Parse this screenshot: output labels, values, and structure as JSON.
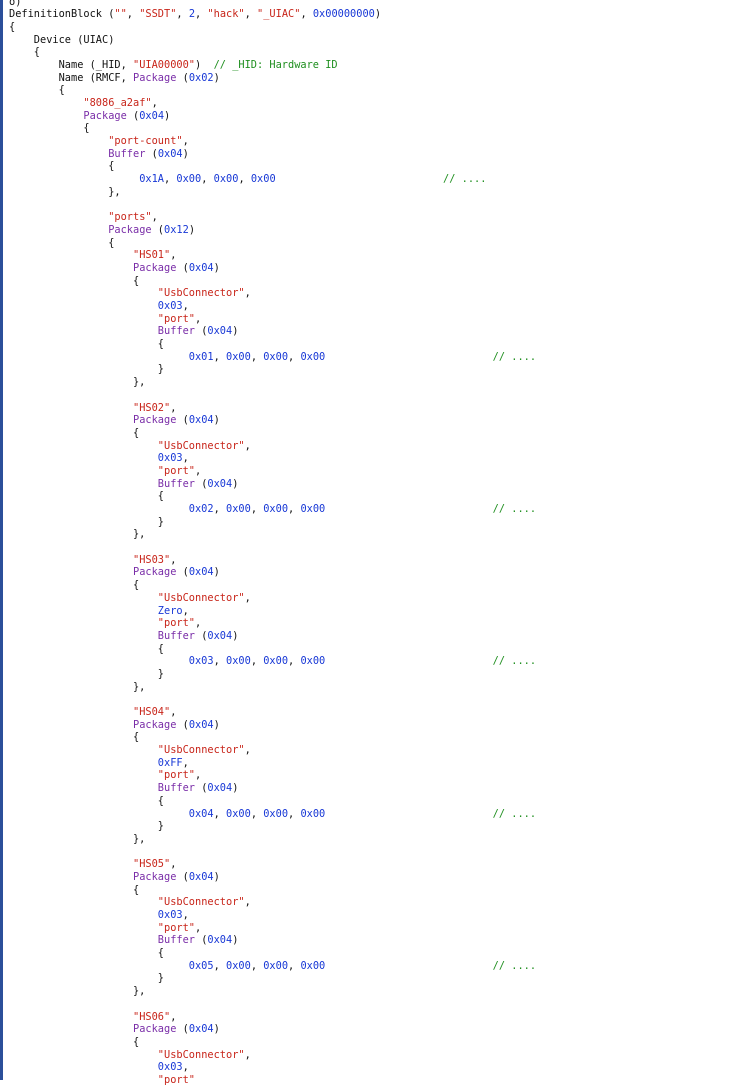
{
  "colors": {
    "text": "#111111",
    "keyword": "#7a2ea8",
    "string": "#c8251a",
    "number": "#1838d6",
    "comment": "#1f8f1f",
    "gutter": "#2b4f9a"
  },
  "editor": {
    "lines": [
      [
        {
          "t": "o)",
          "k": "t"
        }
      ],
      [
        {
          "t": "DefinitionBlock (",
          "k": "t"
        },
        {
          "t": "\"\"",
          "k": "s"
        },
        {
          "t": ", ",
          "k": "t"
        },
        {
          "t": "\"SSDT\"",
          "k": "s"
        },
        {
          "t": ", ",
          "k": "t"
        },
        {
          "t": "2",
          "k": "n"
        },
        {
          "t": ", ",
          "k": "t"
        },
        {
          "t": "\"hack\"",
          "k": "s"
        },
        {
          "t": ", ",
          "k": "t"
        },
        {
          "t": "\"_UIAC\"",
          "k": "s"
        },
        {
          "t": ", ",
          "k": "t"
        },
        {
          "t": "0x00000000",
          "k": "n"
        },
        {
          "t": ")",
          "k": "t"
        }
      ],
      [
        {
          "t": "{",
          "k": "t"
        }
      ],
      [
        {
          "t": "    Device (UIAC)",
          "k": "t"
        }
      ],
      [
        {
          "t": "    {",
          "k": "t"
        }
      ],
      [
        {
          "t": "        Name (_HID, ",
          "k": "t"
        },
        {
          "t": "\"UIA00000\"",
          "k": "s"
        },
        {
          "t": ")  ",
          "k": "t"
        },
        {
          "t": "// _HID: Hardware ID",
          "k": "c"
        }
      ],
      [
        {
          "t": "        Name (RMCF, ",
          "k": "t"
        },
        {
          "t": "Package",
          "k": "k"
        },
        {
          "t": " (",
          "k": "t"
        },
        {
          "t": "0x02",
          "k": "n"
        },
        {
          "t": ")",
          "k": "t"
        }
      ],
      [
        {
          "t": "        {",
          "k": "t"
        }
      ],
      [
        {
          "t": "            ",
          "k": "t"
        },
        {
          "t": "\"8086_a2af\"",
          "k": "s"
        },
        {
          "t": ",",
          "k": "t"
        }
      ],
      [
        {
          "t": "            ",
          "k": "t"
        },
        {
          "t": "Package",
          "k": "k"
        },
        {
          "t": " (",
          "k": "t"
        },
        {
          "t": "0x04",
          "k": "n"
        },
        {
          "t": ")",
          "k": "t"
        }
      ],
      [
        {
          "t": "            {",
          "k": "t"
        }
      ],
      [
        {
          "t": "                ",
          "k": "t"
        },
        {
          "t": "\"port-count\"",
          "k": "s"
        },
        {
          "t": ",",
          "k": "t"
        }
      ],
      [
        {
          "t": "                ",
          "k": "t"
        },
        {
          "t": "Buffer",
          "k": "k"
        },
        {
          "t": " (",
          "k": "t"
        },
        {
          "t": "0x04",
          "k": "n"
        },
        {
          "t": ")",
          "k": "t"
        }
      ],
      [
        {
          "t": "                {",
          "k": "t"
        }
      ],
      [
        {
          "t": "                     ",
          "k": "t"
        },
        {
          "t": "0x1A",
          "k": "n"
        },
        {
          "t": ", ",
          "k": "t"
        },
        {
          "t": "0x00",
          "k": "n"
        },
        {
          "t": ", ",
          "k": "t"
        },
        {
          "t": "0x00",
          "k": "n"
        },
        {
          "t": ", ",
          "k": "t"
        },
        {
          "t": "0x00",
          "k": "n"
        },
        {
          "t": "                           ",
          "k": "t"
        },
        {
          "t": "// ....",
          "k": "c"
        }
      ],
      [
        {
          "t": "                },",
          "k": "t"
        }
      ],
      [
        {
          "t": "",
          "k": "t"
        }
      ],
      [
        {
          "t": "                ",
          "k": "t"
        },
        {
          "t": "\"ports\"",
          "k": "s"
        },
        {
          "t": ",",
          "k": "t"
        }
      ],
      [
        {
          "t": "                ",
          "k": "t"
        },
        {
          "t": "Package",
          "k": "k"
        },
        {
          "t": " (",
          "k": "t"
        },
        {
          "t": "0x12",
          "k": "n"
        },
        {
          "t": ")",
          "k": "t"
        }
      ],
      [
        {
          "t": "                {",
          "k": "t"
        }
      ],
      [
        {
          "t": "                    ",
          "k": "t"
        },
        {
          "t": "\"HS01\"",
          "k": "s"
        },
        {
          "t": ",",
          "k": "t"
        }
      ],
      [
        {
          "t": "                    ",
          "k": "t"
        },
        {
          "t": "Package",
          "k": "k"
        },
        {
          "t": " (",
          "k": "t"
        },
        {
          "t": "0x04",
          "k": "n"
        },
        {
          "t": ")",
          "k": "t"
        }
      ],
      [
        {
          "t": "                    {",
          "k": "t"
        }
      ],
      [
        {
          "t": "                        ",
          "k": "t"
        },
        {
          "t": "\"UsbConnector\"",
          "k": "s"
        },
        {
          "t": ",",
          "k": "t"
        }
      ],
      [
        {
          "t": "                        ",
          "k": "t"
        },
        {
          "t": "0x03",
          "k": "n"
        },
        {
          "t": ",",
          "k": "t"
        }
      ],
      [
        {
          "t": "                        ",
          "k": "t"
        },
        {
          "t": "\"port\"",
          "k": "s"
        },
        {
          "t": ",",
          "k": "t"
        }
      ],
      [
        {
          "t": "                        ",
          "k": "t"
        },
        {
          "t": "Buffer",
          "k": "k"
        },
        {
          "t": " (",
          "k": "t"
        },
        {
          "t": "0x04",
          "k": "n"
        },
        {
          "t": ")",
          "k": "t"
        }
      ],
      [
        {
          "t": "                        {",
          "k": "t"
        }
      ],
      [
        {
          "t": "                             ",
          "k": "t"
        },
        {
          "t": "0x01",
          "k": "n"
        },
        {
          "t": ", ",
          "k": "t"
        },
        {
          "t": "0x00",
          "k": "n"
        },
        {
          "t": ", ",
          "k": "t"
        },
        {
          "t": "0x00",
          "k": "n"
        },
        {
          "t": ", ",
          "k": "t"
        },
        {
          "t": "0x00",
          "k": "n"
        },
        {
          "t": "                           ",
          "k": "t"
        },
        {
          "t": "// ....",
          "k": "c"
        }
      ],
      [
        {
          "t": "                        }",
          "k": "t"
        }
      ],
      [
        {
          "t": "                    },",
          "k": "t"
        }
      ],
      [
        {
          "t": "",
          "k": "t"
        }
      ],
      [
        {
          "t": "                    ",
          "k": "t"
        },
        {
          "t": "\"HS02\"",
          "k": "s"
        },
        {
          "t": ",",
          "k": "t"
        }
      ],
      [
        {
          "t": "                    ",
          "k": "t"
        },
        {
          "t": "Package",
          "k": "k"
        },
        {
          "t": " (",
          "k": "t"
        },
        {
          "t": "0x04",
          "k": "n"
        },
        {
          "t": ")",
          "k": "t"
        }
      ],
      [
        {
          "t": "                    {",
          "k": "t"
        }
      ],
      [
        {
          "t": "                        ",
          "k": "t"
        },
        {
          "t": "\"UsbConnector\"",
          "k": "s"
        },
        {
          "t": ",",
          "k": "t"
        }
      ],
      [
        {
          "t": "                        ",
          "k": "t"
        },
        {
          "t": "0x03",
          "k": "n"
        },
        {
          "t": ",",
          "k": "t"
        }
      ],
      [
        {
          "t": "                        ",
          "k": "t"
        },
        {
          "t": "\"port\"",
          "k": "s"
        },
        {
          "t": ",",
          "k": "t"
        }
      ],
      [
        {
          "t": "                        ",
          "k": "t"
        },
        {
          "t": "Buffer",
          "k": "k"
        },
        {
          "t": " (",
          "k": "t"
        },
        {
          "t": "0x04",
          "k": "n"
        },
        {
          "t": ")",
          "k": "t"
        }
      ],
      [
        {
          "t": "                        {",
          "k": "t"
        }
      ],
      [
        {
          "t": "                             ",
          "k": "t"
        },
        {
          "t": "0x02",
          "k": "n"
        },
        {
          "t": ", ",
          "k": "t"
        },
        {
          "t": "0x00",
          "k": "n"
        },
        {
          "t": ", ",
          "k": "t"
        },
        {
          "t": "0x00",
          "k": "n"
        },
        {
          "t": ", ",
          "k": "t"
        },
        {
          "t": "0x00",
          "k": "n"
        },
        {
          "t": "                           ",
          "k": "t"
        },
        {
          "t": "// ....",
          "k": "c"
        }
      ],
      [
        {
          "t": "                        }",
          "k": "t"
        }
      ],
      [
        {
          "t": "                    },",
          "k": "t"
        }
      ],
      [
        {
          "t": "",
          "k": "t"
        }
      ],
      [
        {
          "t": "                    ",
          "k": "t"
        },
        {
          "t": "\"HS03\"",
          "k": "s"
        },
        {
          "t": ",",
          "k": "t"
        }
      ],
      [
        {
          "t": "                    ",
          "k": "t"
        },
        {
          "t": "Package",
          "k": "k"
        },
        {
          "t": " (",
          "k": "t"
        },
        {
          "t": "0x04",
          "k": "n"
        },
        {
          "t": ")",
          "k": "t"
        }
      ],
      [
        {
          "t": "                    {",
          "k": "t"
        }
      ],
      [
        {
          "t": "                        ",
          "k": "t"
        },
        {
          "t": "\"UsbConnector\"",
          "k": "s"
        },
        {
          "t": ",",
          "k": "t"
        }
      ],
      [
        {
          "t": "                        ",
          "k": "t"
        },
        {
          "t": "Zero",
          "k": "n"
        },
        {
          "t": ",",
          "k": "t"
        }
      ],
      [
        {
          "t": "                        ",
          "k": "t"
        },
        {
          "t": "\"port\"",
          "k": "s"
        },
        {
          "t": ",",
          "k": "t"
        }
      ],
      [
        {
          "t": "                        ",
          "k": "t"
        },
        {
          "t": "Buffer",
          "k": "k"
        },
        {
          "t": " (",
          "k": "t"
        },
        {
          "t": "0x04",
          "k": "n"
        },
        {
          "t": ")",
          "k": "t"
        }
      ],
      [
        {
          "t": "                        {",
          "k": "t"
        }
      ],
      [
        {
          "t": "                             ",
          "k": "t"
        },
        {
          "t": "0x03",
          "k": "n"
        },
        {
          "t": ", ",
          "k": "t"
        },
        {
          "t": "0x00",
          "k": "n"
        },
        {
          "t": ", ",
          "k": "t"
        },
        {
          "t": "0x00",
          "k": "n"
        },
        {
          "t": ", ",
          "k": "t"
        },
        {
          "t": "0x00",
          "k": "n"
        },
        {
          "t": "                           ",
          "k": "t"
        },
        {
          "t": "// ....",
          "k": "c"
        }
      ],
      [
        {
          "t": "                        }",
          "k": "t"
        }
      ],
      [
        {
          "t": "                    },",
          "k": "t"
        }
      ],
      [
        {
          "t": "",
          "k": "t"
        }
      ],
      [
        {
          "t": "                    ",
          "k": "t"
        },
        {
          "t": "\"HS04\"",
          "k": "s"
        },
        {
          "t": ",",
          "k": "t"
        }
      ],
      [
        {
          "t": "                    ",
          "k": "t"
        },
        {
          "t": "Package",
          "k": "k"
        },
        {
          "t": " (",
          "k": "t"
        },
        {
          "t": "0x04",
          "k": "n"
        },
        {
          "t": ")",
          "k": "t"
        }
      ],
      [
        {
          "t": "                    {",
          "k": "t"
        }
      ],
      [
        {
          "t": "                        ",
          "k": "t"
        },
        {
          "t": "\"UsbConnector\"",
          "k": "s"
        },
        {
          "t": ",",
          "k": "t"
        }
      ],
      [
        {
          "t": "                        ",
          "k": "t"
        },
        {
          "t": "0xFF",
          "k": "n"
        },
        {
          "t": ",",
          "k": "t"
        }
      ],
      [
        {
          "t": "                        ",
          "k": "t"
        },
        {
          "t": "\"port\"",
          "k": "s"
        },
        {
          "t": ",",
          "k": "t"
        }
      ],
      [
        {
          "t": "                        ",
          "k": "t"
        },
        {
          "t": "Buffer",
          "k": "k"
        },
        {
          "t": " (",
          "k": "t"
        },
        {
          "t": "0x04",
          "k": "n"
        },
        {
          "t": ")",
          "k": "t"
        }
      ],
      [
        {
          "t": "                        {",
          "k": "t"
        }
      ],
      [
        {
          "t": "                             ",
          "k": "t"
        },
        {
          "t": "0x04",
          "k": "n"
        },
        {
          "t": ", ",
          "k": "t"
        },
        {
          "t": "0x00",
          "k": "n"
        },
        {
          "t": ", ",
          "k": "t"
        },
        {
          "t": "0x00",
          "k": "n"
        },
        {
          "t": ", ",
          "k": "t"
        },
        {
          "t": "0x00",
          "k": "n"
        },
        {
          "t": "                           ",
          "k": "t"
        },
        {
          "t": "// ....",
          "k": "c"
        }
      ],
      [
        {
          "t": "                        }",
          "k": "t"
        }
      ],
      [
        {
          "t": "                    },",
          "k": "t"
        }
      ],
      [
        {
          "t": "",
          "k": "t"
        }
      ],
      [
        {
          "t": "                    ",
          "k": "t"
        },
        {
          "t": "\"HS05\"",
          "k": "s"
        },
        {
          "t": ",",
          "k": "t"
        }
      ],
      [
        {
          "t": "                    ",
          "k": "t"
        },
        {
          "t": "Package",
          "k": "k"
        },
        {
          "t": " (",
          "k": "t"
        },
        {
          "t": "0x04",
          "k": "n"
        },
        {
          "t": ")",
          "k": "t"
        }
      ],
      [
        {
          "t": "                    {",
          "k": "t"
        }
      ],
      [
        {
          "t": "                        ",
          "k": "t"
        },
        {
          "t": "\"UsbConnector\"",
          "k": "s"
        },
        {
          "t": ",",
          "k": "t"
        }
      ],
      [
        {
          "t": "                        ",
          "k": "t"
        },
        {
          "t": "0x03",
          "k": "n"
        },
        {
          "t": ",",
          "k": "t"
        }
      ],
      [
        {
          "t": "                        ",
          "k": "t"
        },
        {
          "t": "\"port\"",
          "k": "s"
        },
        {
          "t": ",",
          "k": "t"
        }
      ],
      [
        {
          "t": "                        ",
          "k": "t"
        },
        {
          "t": "Buffer",
          "k": "k"
        },
        {
          "t": " (",
          "k": "t"
        },
        {
          "t": "0x04",
          "k": "n"
        },
        {
          "t": ")",
          "k": "t"
        }
      ],
      [
        {
          "t": "                        {",
          "k": "t"
        }
      ],
      [
        {
          "t": "                             ",
          "k": "t"
        },
        {
          "t": "0x05",
          "k": "n"
        },
        {
          "t": ", ",
          "k": "t"
        },
        {
          "t": "0x00",
          "k": "n"
        },
        {
          "t": ", ",
          "k": "t"
        },
        {
          "t": "0x00",
          "k": "n"
        },
        {
          "t": ", ",
          "k": "t"
        },
        {
          "t": "0x00",
          "k": "n"
        },
        {
          "t": "                           ",
          "k": "t"
        },
        {
          "t": "// ....",
          "k": "c"
        }
      ],
      [
        {
          "t": "                        }",
          "k": "t"
        }
      ],
      [
        {
          "t": "                    },",
          "k": "t"
        }
      ],
      [
        {
          "t": "",
          "k": "t"
        }
      ],
      [
        {
          "t": "                    ",
          "k": "t"
        },
        {
          "t": "\"HS06\"",
          "k": "s"
        },
        {
          "t": ",",
          "k": "t"
        }
      ],
      [
        {
          "t": "                    ",
          "k": "t"
        },
        {
          "t": "Package",
          "k": "k"
        },
        {
          "t": " (",
          "k": "t"
        },
        {
          "t": "0x04",
          "k": "n"
        },
        {
          "t": ")",
          "k": "t"
        }
      ],
      [
        {
          "t": "                    {",
          "k": "t"
        }
      ],
      [
        {
          "t": "                        ",
          "k": "t"
        },
        {
          "t": "\"UsbConnector\"",
          "k": "s"
        },
        {
          "t": ",",
          "k": "t"
        }
      ],
      [
        {
          "t": "                        ",
          "k": "t"
        },
        {
          "t": "0x03",
          "k": "n"
        },
        {
          "t": ",",
          "k": "t"
        }
      ],
      [
        {
          "t": "                        ",
          "k": "t"
        },
        {
          "t": "\"port\"",
          "k": "s"
        }
      ]
    ]
  }
}
